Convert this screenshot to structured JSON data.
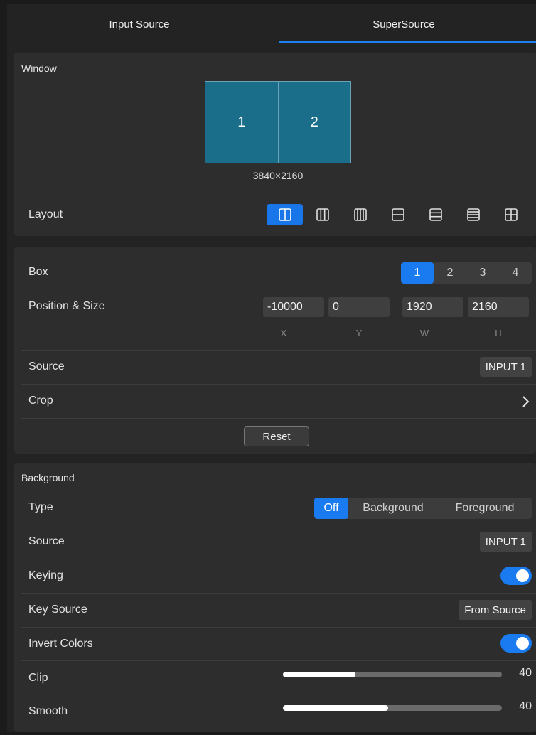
{
  "tabs": [
    {
      "label": "Input Source",
      "active": false
    },
    {
      "label": "SuperSource",
      "active": true
    }
  ],
  "window": {
    "title": "Window",
    "preview_cells": [
      "1",
      "2"
    ],
    "resolution": "3840×2160",
    "layout_label": "Layout",
    "layout_icons": [
      {
        "name": "layout-2-columns-icon",
        "active": true
      },
      {
        "name": "layout-3-columns-icon",
        "active": false
      },
      {
        "name": "layout-4-columns-icon",
        "active": false
      },
      {
        "name": "layout-2-rows-icon",
        "active": false
      },
      {
        "name": "layout-3-rows-icon",
        "active": false
      },
      {
        "name": "layout-4-rows-icon",
        "active": false
      },
      {
        "name": "layout-grid-icon",
        "active": false
      }
    ]
  },
  "box": {
    "label": "Box",
    "options": [
      "1",
      "2",
      "3",
      "4"
    ],
    "selected": "1",
    "position_label": "Position & Size",
    "x": "-10000",
    "y": "0",
    "w": "1920",
    "h": "2160",
    "axis_labels": [
      "X",
      "Y",
      "W",
      "H"
    ],
    "source_label": "Source",
    "source_value": "INPUT 1",
    "crop_label": "Crop",
    "reset_label": "Reset"
  },
  "background": {
    "title": "Background",
    "type_label": "Type",
    "type_options": [
      "Off",
      "Background",
      "Foreground"
    ],
    "type_selected": "Off",
    "source_label": "Source",
    "source_value": "INPUT 1",
    "keying_label": "Keying",
    "keying_on": true,
    "key_source_label": "Key Source",
    "key_source_value": "From Source",
    "invert_label": "Invert Colors",
    "invert_on": true,
    "clip_label": "Clip",
    "clip_value": "40",
    "clip_fraction": 0.33,
    "smooth_label": "Smooth",
    "smooth_value": "40",
    "smooth_fraction": 0.48
  },
  "colors": {
    "accent": "#1a7bf0",
    "preview_fill": "#1a6e8a"
  }
}
